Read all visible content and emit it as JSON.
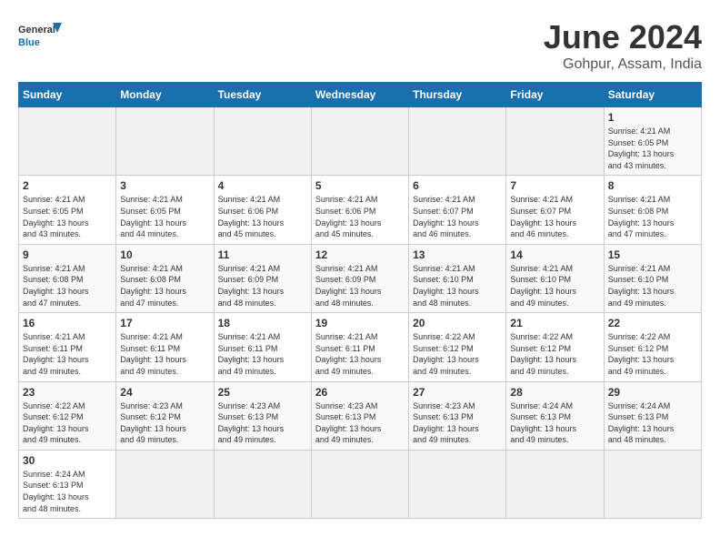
{
  "header": {
    "logo": {
      "general": "General",
      "blue": "Blue"
    },
    "title": "June 2024",
    "subtitle": "Gohpur, Assam, India"
  },
  "days_of_week": [
    "Sunday",
    "Monday",
    "Tuesday",
    "Wednesday",
    "Thursday",
    "Friday",
    "Saturday"
  ],
  "weeks": [
    [
      {
        "day": "",
        "info": ""
      },
      {
        "day": "",
        "info": ""
      },
      {
        "day": "",
        "info": ""
      },
      {
        "day": "",
        "info": ""
      },
      {
        "day": "",
        "info": ""
      },
      {
        "day": "",
        "info": ""
      },
      {
        "day": "1",
        "info": "Sunrise: 4:21 AM\nSunset: 6:05 PM\nDaylight: 13 hours\nand 43 minutes."
      }
    ],
    [
      {
        "day": "2",
        "info": "Sunrise: 4:21 AM\nSunset: 6:05 PM\nDaylight: 13 hours\nand 43 minutes."
      },
      {
        "day": "3",
        "info": "Sunrise: 4:21 AM\nSunset: 6:05 PM\nDaylight: 13 hours\nand 44 minutes."
      },
      {
        "day": "4",
        "info": "Sunrise: 4:21 AM\nSunset: 6:06 PM\nDaylight: 13 hours\nand 45 minutes."
      },
      {
        "day": "5",
        "info": "Sunrise: 4:21 AM\nSunset: 6:06 PM\nDaylight: 13 hours\nand 45 minutes."
      },
      {
        "day": "6",
        "info": "Sunrise: 4:21 AM\nSunset: 6:07 PM\nDaylight: 13 hours\nand 46 minutes."
      },
      {
        "day": "7",
        "info": "Sunrise: 4:21 AM\nSunset: 6:07 PM\nDaylight: 13 hours\nand 46 minutes."
      },
      {
        "day": "8",
        "info": "Sunrise: 4:21 AM\nSunset: 6:08 PM\nDaylight: 13 hours\nand 47 minutes."
      }
    ],
    [
      {
        "day": "9",
        "info": "Sunrise: 4:21 AM\nSunset: 6:08 PM\nDaylight: 13 hours\nand 47 minutes."
      },
      {
        "day": "10",
        "info": "Sunrise: 4:21 AM\nSunset: 6:08 PM\nDaylight: 13 hours\nand 47 minutes."
      },
      {
        "day": "11",
        "info": "Sunrise: 4:21 AM\nSunset: 6:09 PM\nDaylight: 13 hours\nand 48 minutes."
      },
      {
        "day": "12",
        "info": "Sunrise: 4:21 AM\nSunset: 6:09 PM\nDaylight: 13 hours\nand 48 minutes."
      },
      {
        "day": "13",
        "info": "Sunrise: 4:21 AM\nSunset: 6:10 PM\nDaylight: 13 hours\nand 48 minutes."
      },
      {
        "day": "14",
        "info": "Sunrise: 4:21 AM\nSunset: 6:10 PM\nDaylight: 13 hours\nand 49 minutes."
      },
      {
        "day": "15",
        "info": "Sunrise: 4:21 AM\nSunset: 6:10 PM\nDaylight: 13 hours\nand 49 minutes."
      }
    ],
    [
      {
        "day": "16",
        "info": "Sunrise: 4:21 AM\nSunset: 6:11 PM\nDaylight: 13 hours\nand 49 minutes."
      },
      {
        "day": "17",
        "info": "Sunrise: 4:21 AM\nSunset: 6:11 PM\nDaylight: 13 hours\nand 49 minutes."
      },
      {
        "day": "18",
        "info": "Sunrise: 4:21 AM\nSunset: 6:11 PM\nDaylight: 13 hours\nand 49 minutes."
      },
      {
        "day": "19",
        "info": "Sunrise: 4:21 AM\nSunset: 6:11 PM\nDaylight: 13 hours\nand 49 minutes."
      },
      {
        "day": "20",
        "info": "Sunrise: 4:22 AM\nSunset: 6:12 PM\nDaylight: 13 hours\nand 49 minutes."
      },
      {
        "day": "21",
        "info": "Sunrise: 4:22 AM\nSunset: 6:12 PM\nDaylight: 13 hours\nand 49 minutes."
      },
      {
        "day": "22",
        "info": "Sunrise: 4:22 AM\nSunset: 6:12 PM\nDaylight: 13 hours\nand 49 minutes."
      }
    ],
    [
      {
        "day": "23",
        "info": "Sunrise: 4:22 AM\nSunset: 6:12 PM\nDaylight: 13 hours\nand 49 minutes."
      },
      {
        "day": "24",
        "info": "Sunrise: 4:23 AM\nSunset: 6:12 PM\nDaylight: 13 hours\nand 49 minutes."
      },
      {
        "day": "25",
        "info": "Sunrise: 4:23 AM\nSunset: 6:13 PM\nDaylight: 13 hours\nand 49 minutes."
      },
      {
        "day": "26",
        "info": "Sunrise: 4:23 AM\nSunset: 6:13 PM\nDaylight: 13 hours\nand 49 minutes."
      },
      {
        "day": "27",
        "info": "Sunrise: 4:23 AM\nSunset: 6:13 PM\nDaylight: 13 hours\nand 49 minutes."
      },
      {
        "day": "28",
        "info": "Sunrise: 4:24 AM\nSunset: 6:13 PM\nDaylight: 13 hours\nand 49 minutes."
      },
      {
        "day": "29",
        "info": "Sunrise: 4:24 AM\nSunset: 6:13 PM\nDaylight: 13 hours\nand 48 minutes."
      }
    ],
    [
      {
        "day": "30",
        "info": "Sunrise: 4:24 AM\nSunset: 6:13 PM\nDaylight: 13 hours\nand 48 minutes."
      },
      {
        "day": "",
        "info": ""
      },
      {
        "day": "",
        "info": ""
      },
      {
        "day": "",
        "info": ""
      },
      {
        "day": "",
        "info": ""
      },
      {
        "day": "",
        "info": ""
      },
      {
        "day": "",
        "info": ""
      }
    ]
  ]
}
